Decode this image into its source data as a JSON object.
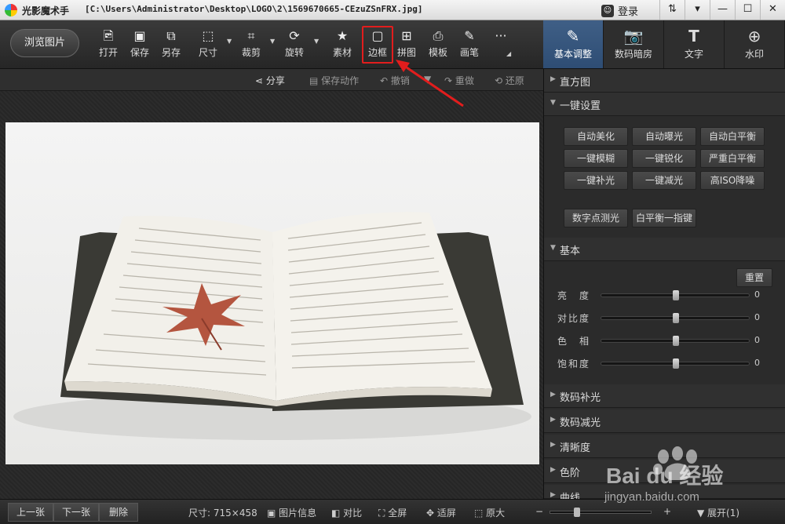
{
  "titlebar": {
    "app_name": "光影魔术手",
    "file_path": "[C:\\Users\\Administrator\\Desktop\\LOGO\\2\\1569670665-CEzuZSnFRX.jpg]",
    "login_label": "登录",
    "buttons": [
      "⇅",
      "▾",
      "—",
      "☐",
      "✕"
    ]
  },
  "toolbar": {
    "browse_label": "浏览图片",
    "tools": [
      {
        "label": "打开",
        "icon": "open-icon"
      },
      {
        "label": "保存",
        "icon": "save-icon"
      },
      {
        "label": "另存",
        "icon": "save-as-icon"
      },
      {
        "label": "尺寸",
        "icon": "resize-icon"
      },
      {
        "label": "裁剪",
        "icon": "crop-icon"
      },
      {
        "label": "旋转",
        "icon": "rotate-icon"
      },
      {
        "label": "素材",
        "icon": "material-icon"
      },
      {
        "label": "边框",
        "icon": "frame-icon"
      },
      {
        "label": "拼图",
        "icon": "collage-icon"
      },
      {
        "label": "模板",
        "icon": "template-icon"
      },
      {
        "label": "画笔",
        "icon": "brush-icon"
      }
    ],
    "more_label": "···"
  },
  "right_tabs": [
    {
      "label": "基本调整",
      "icon": "edit-icon",
      "active": true
    },
    {
      "label": "数码暗房",
      "icon": "camera-icon",
      "active": false
    },
    {
      "label": "文字",
      "icon": "text-icon",
      "active": false
    },
    {
      "label": "水印",
      "icon": "watermark-icon",
      "active": false
    }
  ],
  "subbar": {
    "share": "分享",
    "save_action": "保存动作",
    "undo": "撤销",
    "redo": "重做",
    "restore": "还原"
  },
  "panel": {
    "histogram": "直方图",
    "one_click": "一键设置",
    "one_click_buttons": [
      "自动美化",
      "自动曝光",
      "自动白平衡",
      "一键模糊",
      "一键锐化",
      "严重白平衡",
      "一键补光",
      "一键减光",
      "高ISO降噪"
    ],
    "extra_buttons": [
      "数字点测光",
      "白平衡一指键"
    ],
    "basic": "基本",
    "reset": "重置",
    "sliders": [
      {
        "label": "亮　度",
        "value": "0"
      },
      {
        "label": "对比度",
        "value": "0"
      },
      {
        "label": "色　相",
        "value": "0"
      },
      {
        "label": "饱和度",
        "value": "0"
      }
    ],
    "sections": [
      "数码补光",
      "数码减光",
      "清晰度",
      "色阶",
      "曲线"
    ]
  },
  "bottombar": {
    "prev": "上一张",
    "next": "下一张",
    "delete": "删除",
    "size": "尺寸: 715×458",
    "info": "图片信息",
    "compare": "对比",
    "fullscreen": "全屏",
    "fit": "适屏",
    "original": "原大",
    "minus": "−",
    "plus": "+",
    "expand": "展开(1)"
  },
  "watermark": {
    "brand": "Bai du 经验",
    "url": "jingyan.baidu.com"
  },
  "colors": {
    "accent": "#2e4d74",
    "highlight": "#e21d1d"
  }
}
